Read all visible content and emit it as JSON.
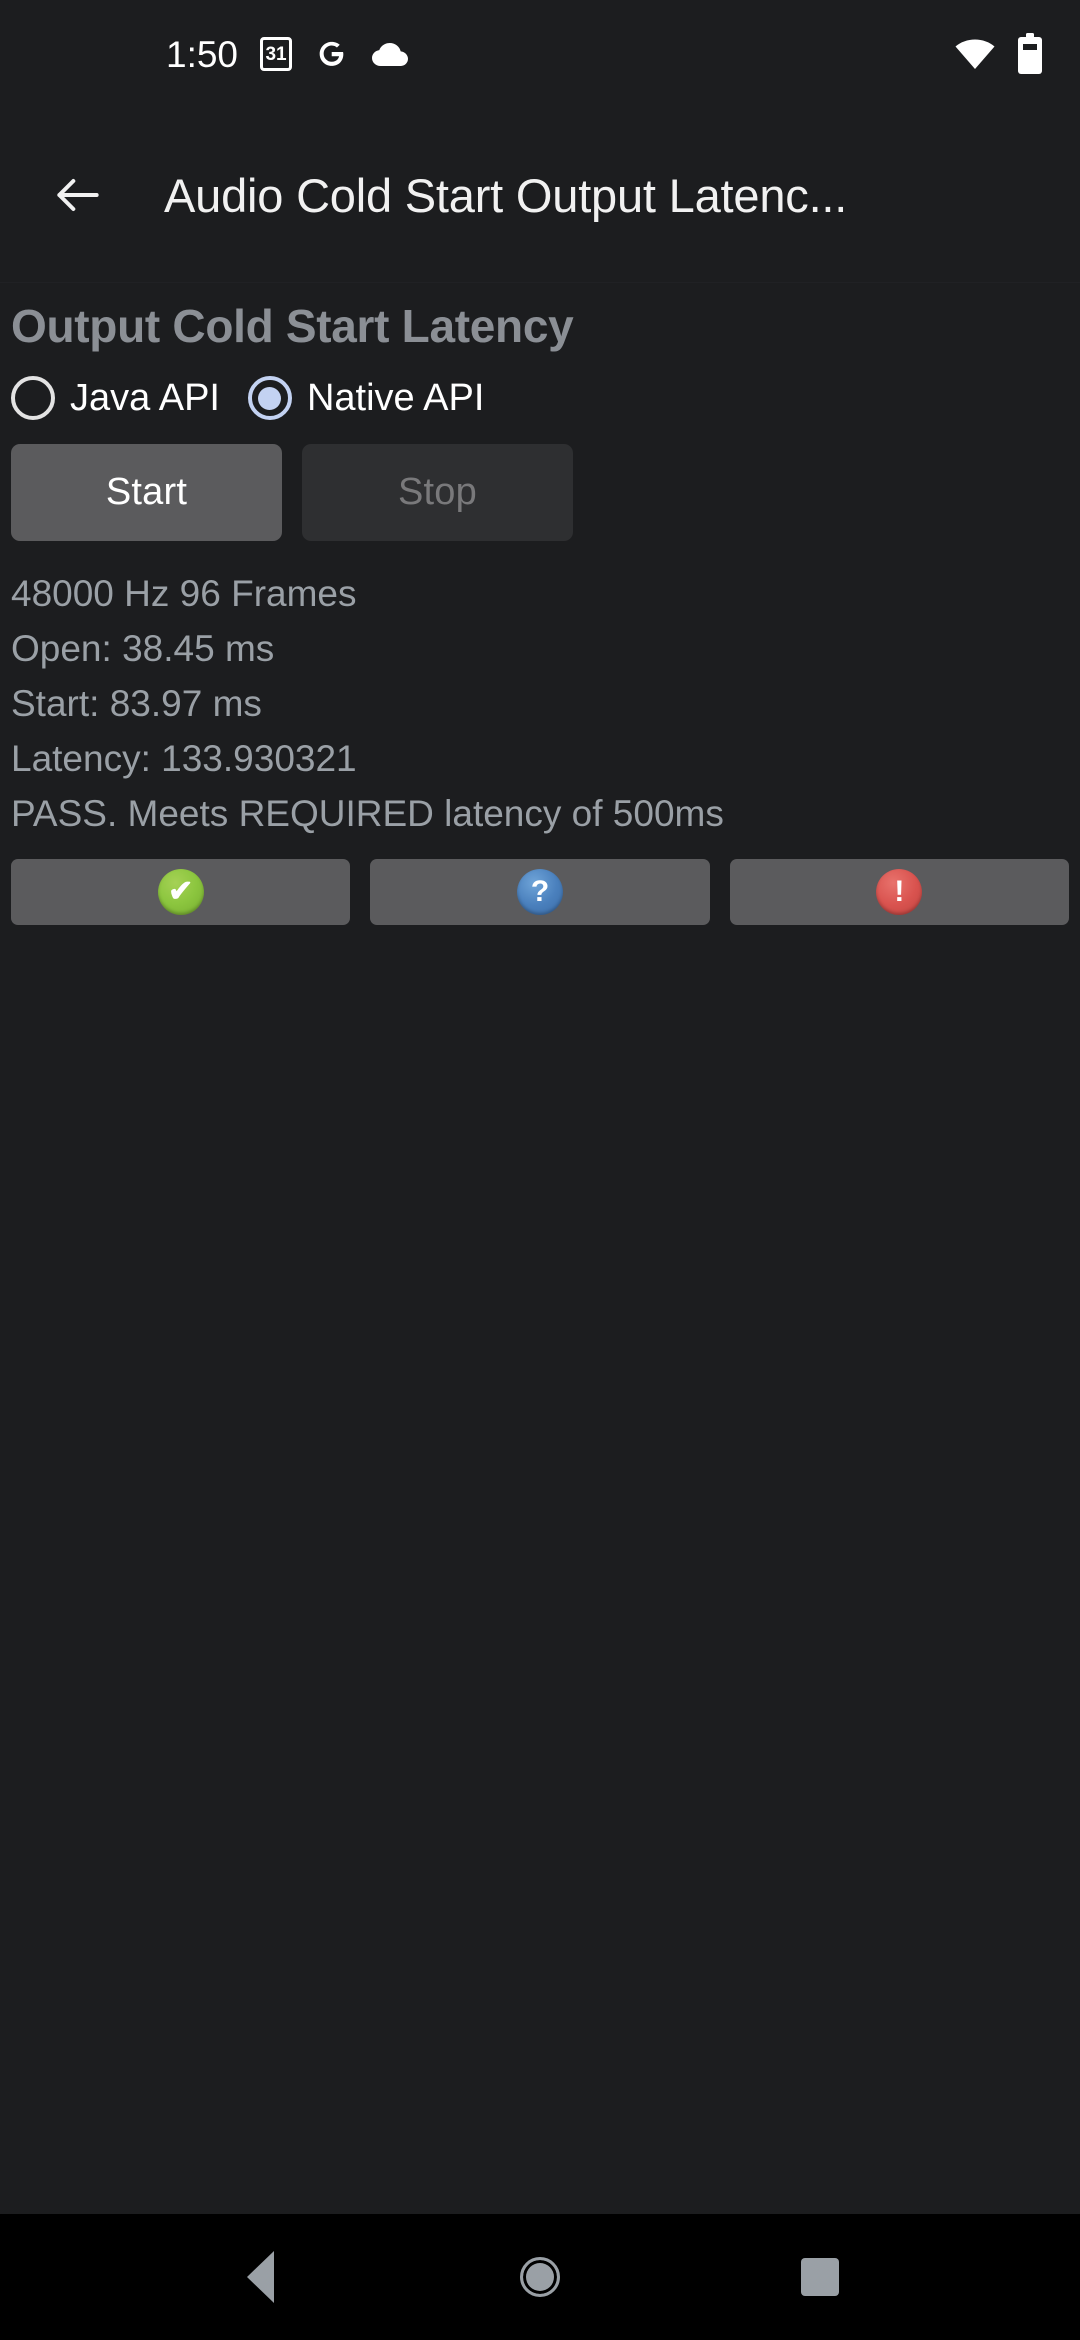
{
  "status_bar": {
    "time": "1:50",
    "calendar_day": "31",
    "icons": [
      "calendar-31-icon",
      "google-g-icon",
      "cloud-icon",
      "wifi-icon",
      "battery-icon"
    ]
  },
  "app_bar": {
    "back_icon": "back-arrow-icon",
    "title": "Audio Cold Start Output Latenc..."
  },
  "main": {
    "heading": "Output Cold Start Latency",
    "api_options": [
      {
        "label": "Java API",
        "selected": false
      },
      {
        "label": "Native API",
        "selected": true
      }
    ],
    "buttons": {
      "start_label": "Start",
      "start_enabled": true,
      "stop_label": "Stop",
      "stop_enabled": false
    },
    "results": [
      "48000 Hz 96 Frames",
      "Open: 38.45 ms",
      "Start: 83.97 ms",
      "Latency: 133.930321",
      "PASS. Meets REQUIRED latency of 500ms"
    ],
    "status_buttons": [
      {
        "icon": "check-circle-icon",
        "glyph": "✔",
        "color": "#8cc63f"
      },
      {
        "icon": "question-circle-icon",
        "glyph": "?",
        "color": "#4a80bd"
      },
      {
        "icon": "error-circle-icon",
        "glyph": "!",
        "color": "#d9534f"
      }
    ]
  },
  "nav_bar": {
    "back": "nav-back-button",
    "home": "nav-home-button",
    "recents": "nav-recents-button"
  },
  "colors": {
    "background": "#1c1d1f",
    "nav_background": "#000000",
    "accent_radio": "#c3d2f2",
    "secondary_text": "#9aa0a6",
    "heading_text": "#8b8f95",
    "button_enabled": "#5b5b5d",
    "button_disabled": "#2e2f31"
  }
}
